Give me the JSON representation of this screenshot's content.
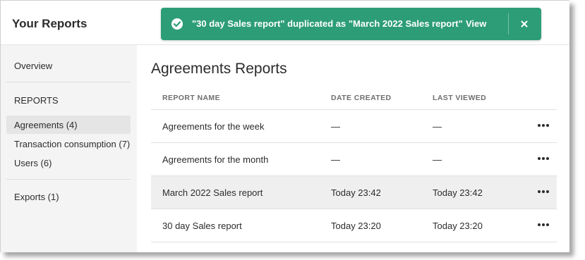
{
  "header": {
    "app_title": "Your Reports"
  },
  "toast": {
    "message": "\"30 day Sales report\" duplicated as \"March 2022 Sales report\"",
    "action_label": "View",
    "close_icon": "close-icon",
    "status_icon": "checkmark-circle-icon",
    "color": "#2d9d78"
  },
  "sidebar": {
    "overview_label": "Overview",
    "section_label": "REPORTS",
    "items": [
      {
        "label": "Agreements (4)",
        "active": true
      },
      {
        "label": "Transaction consumption (7)",
        "active": false
      },
      {
        "label": "Users (6)",
        "active": false
      }
    ],
    "exports_label": "Exports (1)"
  },
  "main": {
    "title": "Agreements Reports",
    "columns": [
      "REPORT NAME",
      "DATE CREATED",
      "LAST VIEWED"
    ],
    "rows": [
      {
        "name": "Agreements for the week",
        "created": "—",
        "viewed": "—",
        "highlight": false
      },
      {
        "name": "Agreements for the month",
        "created": "—",
        "viewed": "—",
        "highlight": false
      },
      {
        "name": "March 2022 Sales report",
        "created": "Today 23:42",
        "viewed": "Today 23:42",
        "highlight": true
      },
      {
        "name": "30 day Sales report",
        "created": "Today 23:20",
        "viewed": "Today 23:20",
        "highlight": false
      }
    ],
    "row_action_icon": "more-horizontal-icon"
  }
}
